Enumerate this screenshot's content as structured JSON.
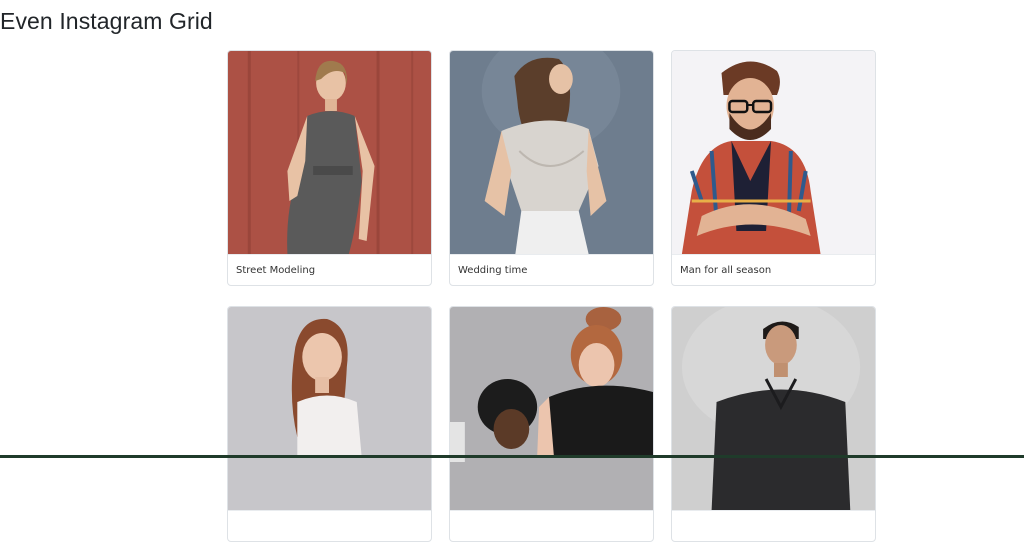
{
  "page": {
    "title": "Even Instagram Grid"
  },
  "cards": [
    {
      "caption": "Street Modeling"
    },
    {
      "caption": "Wedding time"
    },
    {
      "caption": "Man for all season"
    },
    {
      "caption": ""
    },
    {
      "caption": ""
    },
    {
      "caption": ""
    }
  ],
  "colors": {
    "card_border": "#dee2e6",
    "page_background": "#ffffff",
    "text": "#212529"
  }
}
